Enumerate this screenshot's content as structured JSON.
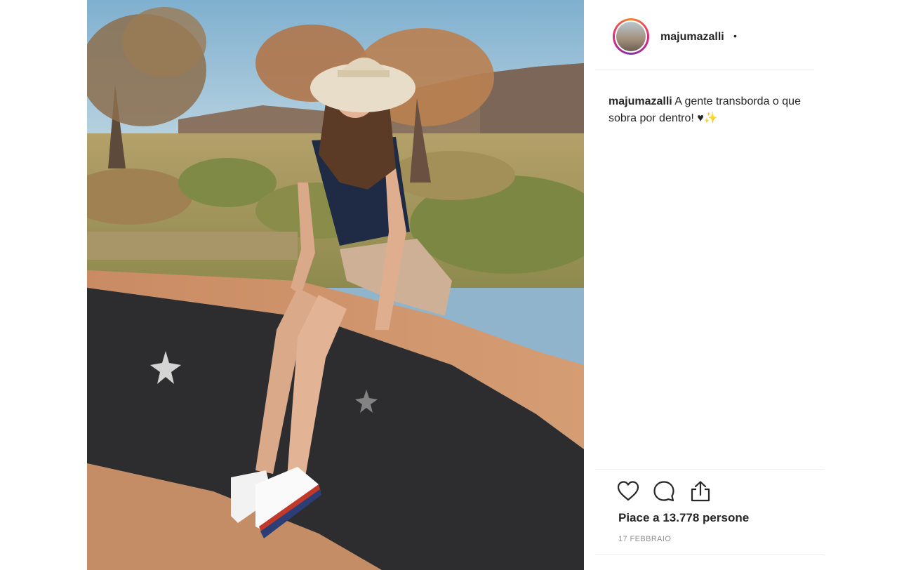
{
  "post": {
    "username": "majumazalli",
    "header_separator": "•",
    "caption_user": "majumazalli",
    "caption_text": "A gente transborda o que sobra por dentro! ♥✨",
    "likes_text": "Piace a 13.778 persone",
    "date_text": "17 FEBBRAIO"
  },
  "icons": {
    "like": "heart-icon",
    "comment": "comment-icon",
    "share": "share-icon"
  },
  "colors": {
    "text": "#262626",
    "muted": "#8e8e8e",
    "divider": "#efefef"
  }
}
